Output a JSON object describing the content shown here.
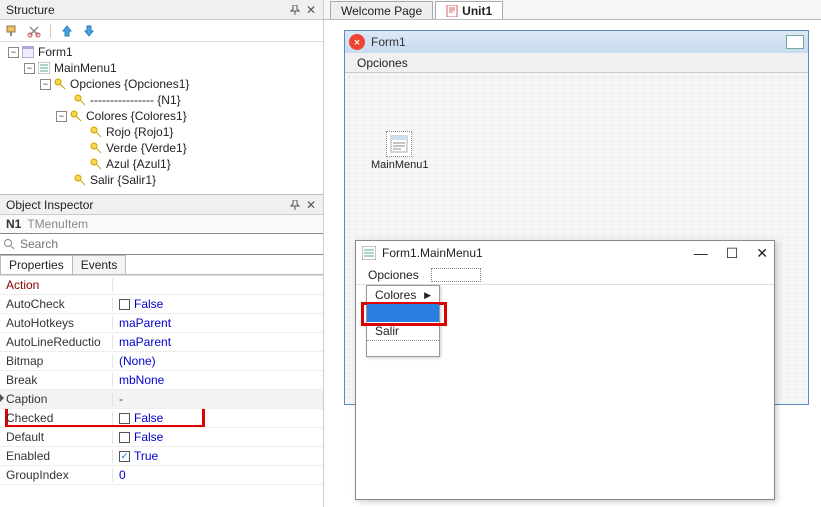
{
  "structure": {
    "title": "Structure",
    "tree": {
      "form": "Form1",
      "mainmenu": "MainMenu1",
      "opciones": "Opciones {Opciones1}",
      "sep_item": "---------------- {N1}",
      "colores": "Colores {Colores1}",
      "rojo": "Rojo {Rojo1}",
      "verde": "Verde {Verde1}",
      "azul": "Azul {Azul1}",
      "salir": "Salir {Salir1}"
    }
  },
  "inspector": {
    "title": "Object Inspector",
    "obj_name": "N1",
    "obj_type": "TMenuItem",
    "search_placeholder": "Search",
    "tab_properties": "Properties",
    "tab_events": "Events",
    "rows": {
      "action": "Action",
      "autocheck": "AutoCheck",
      "autohotkeys": "AutoHotkeys",
      "autolinered": "AutoLineReductio",
      "bitmap": "Bitmap",
      "break": "Break",
      "caption": "Caption",
      "checked": "Checked",
      "default": "Default",
      "enabled": "Enabled",
      "groupindex": "GroupIndex"
    },
    "vals": {
      "false": "False",
      "maparent": "maParent",
      "none": "(None)",
      "mbnone": "mbNone",
      "caption": "-",
      "true": "True",
      "zero": "0"
    }
  },
  "tabs": {
    "welcome": "Welcome Page",
    "unit1": "Unit1"
  },
  "form": {
    "title": "Form1",
    "menu_opciones": "Opciones",
    "comp_label": "MainMenu1"
  },
  "menu_editor": {
    "title": "Form1.MainMenu1",
    "minimize": "—",
    "maximize": "☐",
    "close": "✕",
    "menubar_item": "Opciones",
    "dd_colores": "Colores",
    "dd_salir": "Salir"
  }
}
